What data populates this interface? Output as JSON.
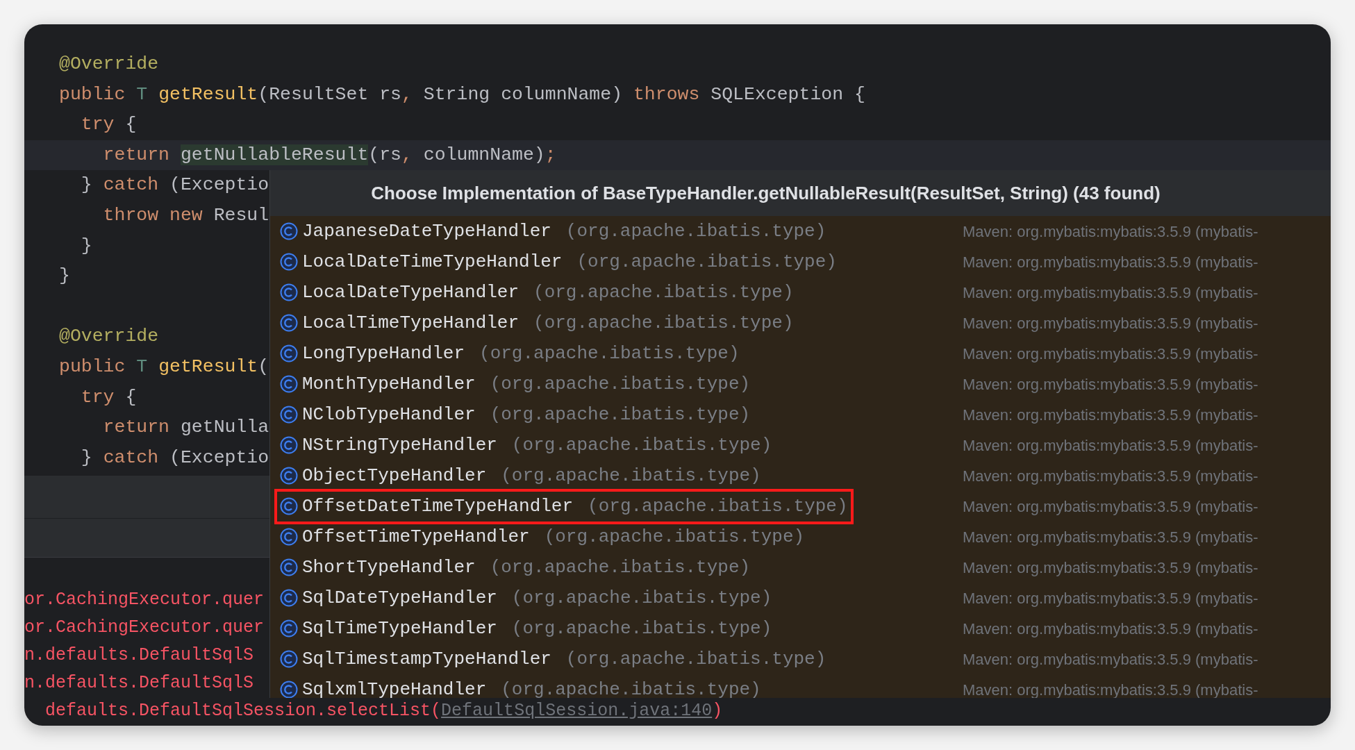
{
  "editor": {
    "lines": [
      {
        "current": false,
        "tokens": [
          {
            "kind": "annotation",
            "text": "@Override"
          }
        ]
      },
      {
        "current": false,
        "tokens": [
          {
            "kind": "keyword",
            "text": "public "
          },
          {
            "kind": "typeparam",
            "text": "T "
          },
          {
            "kind": "method",
            "text": "getResult"
          },
          {
            "kind": "plain",
            "text": "(ResultSet rs"
          },
          {
            "kind": "keyword",
            "text": ", "
          },
          {
            "kind": "plain",
            "text": "String columnName) "
          },
          {
            "kind": "keyword",
            "text": "throws "
          },
          {
            "kind": "plain",
            "text": "SQLException {"
          }
        ]
      },
      {
        "current": false,
        "tokens": [
          {
            "kind": "keyword",
            "text": "  try "
          },
          {
            "kind": "plain",
            "text": "{"
          }
        ]
      },
      {
        "current": true,
        "tokens": [
          {
            "kind": "keyword",
            "text": "    return "
          },
          {
            "kind": "usage",
            "text": "getNullableResult"
          },
          {
            "kind": "plain",
            "text": "(rs"
          },
          {
            "kind": "keyword",
            "text": ", "
          },
          {
            "kind": "plain",
            "text": "columnName)"
          },
          {
            "kind": "keyword",
            "text": ";"
          }
        ]
      },
      {
        "current": false,
        "tokens": [
          {
            "kind": "plain",
            "text": "  } "
          },
          {
            "kind": "keyword",
            "text": "catch "
          },
          {
            "kind": "plain",
            "text": "(Exceptio"
          }
        ]
      },
      {
        "current": false,
        "tokens": [
          {
            "kind": "keyword",
            "text": "    throw new "
          },
          {
            "kind": "plain",
            "text": "Resul"
          }
        ]
      },
      {
        "current": false,
        "tokens": [
          {
            "kind": "plain",
            "text": "  }"
          }
        ]
      },
      {
        "current": false,
        "tokens": [
          {
            "kind": "plain",
            "text": "}"
          }
        ]
      },
      {
        "current": false
      },
      {
        "current": false,
        "tokens": [
          {
            "kind": "annotation",
            "text": "@Override"
          }
        ]
      },
      {
        "current": false,
        "tokens": [
          {
            "kind": "keyword",
            "text": "public "
          },
          {
            "kind": "typeparam",
            "text": "T "
          },
          {
            "kind": "method",
            "text": "getResult"
          },
          {
            "kind": "plain",
            "text": "("
          }
        ]
      },
      {
        "current": false,
        "tokens": [
          {
            "kind": "keyword",
            "text": "  try "
          },
          {
            "kind": "plain",
            "text": "{"
          }
        ]
      },
      {
        "current": false,
        "tokens": [
          {
            "kind": "keyword",
            "text": "    return "
          },
          {
            "kind": "plain",
            "text": "getNulla"
          }
        ]
      },
      {
        "current": false,
        "tokens": [
          {
            "kind": "plain",
            "text": "  } "
          },
          {
            "kind": "keyword",
            "text": "catch "
          },
          {
            "kind": "plain",
            "text": "(Exceptio"
          }
        ]
      }
    ]
  },
  "console": {
    "lines": [
      {
        "segments": [
          {
            "kind": "error",
            "text": "or.CachingExecutor.quer"
          }
        ]
      },
      {
        "segments": [
          {
            "kind": "error",
            "text": "or.CachingExecutor.quer"
          }
        ]
      },
      {
        "segments": [
          {
            "kind": "error",
            "text": "n.defaults.DefaultSqlS"
          }
        ]
      },
      {
        "segments": [
          {
            "kind": "error",
            "text": "n.defaults.DefaultSqlS"
          }
        ]
      },
      {
        "segments": [
          {
            "kind": "error",
            "text": "  defaults.DefaultSqlSession.selectList("
          },
          {
            "kind": "link",
            "text": "DefaultSqlSession.java:140"
          },
          {
            "kind": "error",
            "text": ")"
          }
        ]
      }
    ]
  },
  "popup": {
    "title": "Choose Implementation of BaseTypeHandler.getNullableResult(ResultSet, String) (43 found)",
    "items": [
      {
        "name": "JapaneseDateTypeHandler",
        "package": "(org.apache.ibatis.type)",
        "library": "Maven: org.mybatis:mybatis:3.5.9 (mybatis-",
        "highlighted": false
      },
      {
        "name": "LocalDateTimeTypeHandler",
        "package": "(org.apache.ibatis.type)",
        "library": "Maven: org.mybatis:mybatis:3.5.9 (mybatis-",
        "highlighted": false
      },
      {
        "name": "LocalDateTypeHandler",
        "package": "(org.apache.ibatis.type)",
        "library": "Maven: org.mybatis:mybatis:3.5.9 (mybatis-",
        "highlighted": false
      },
      {
        "name": "LocalTimeTypeHandler",
        "package": "(org.apache.ibatis.type)",
        "library": "Maven: org.mybatis:mybatis:3.5.9 (mybatis-",
        "highlighted": false
      },
      {
        "name": "LongTypeHandler",
        "package": "(org.apache.ibatis.type)",
        "library": "Maven: org.mybatis:mybatis:3.5.9 (mybatis-",
        "highlighted": false
      },
      {
        "name": "MonthTypeHandler",
        "package": "(org.apache.ibatis.type)",
        "library": "Maven: org.mybatis:mybatis:3.5.9 (mybatis-",
        "highlighted": false
      },
      {
        "name": "NClobTypeHandler",
        "package": "(org.apache.ibatis.type)",
        "library": "Maven: org.mybatis:mybatis:3.5.9 (mybatis-",
        "highlighted": false
      },
      {
        "name": "NStringTypeHandler",
        "package": "(org.apache.ibatis.type)",
        "library": "Maven: org.mybatis:mybatis:3.5.9 (mybatis-",
        "highlighted": false
      },
      {
        "name": "ObjectTypeHandler",
        "package": "(org.apache.ibatis.type)",
        "library": "Maven: org.mybatis:mybatis:3.5.9 (mybatis-",
        "highlighted": false
      },
      {
        "name": "OffsetDateTimeTypeHandler",
        "package": "(org.apache.ibatis.type)",
        "library": "Maven: org.mybatis:mybatis:3.5.9 (mybatis-",
        "highlighted": true
      },
      {
        "name": "OffsetTimeTypeHandler",
        "package": "(org.apache.ibatis.type)",
        "library": "Maven: org.mybatis:mybatis:3.5.9 (mybatis-",
        "highlighted": false
      },
      {
        "name": "ShortTypeHandler",
        "package": "(org.apache.ibatis.type)",
        "library": "Maven: org.mybatis:mybatis:3.5.9 (mybatis-",
        "highlighted": false
      },
      {
        "name": "SqlDateTypeHandler",
        "package": "(org.apache.ibatis.type)",
        "library": "Maven: org.mybatis:mybatis:3.5.9 (mybatis-",
        "highlighted": false
      },
      {
        "name": "SqlTimeTypeHandler",
        "package": "(org.apache.ibatis.type)",
        "library": "Maven: org.mybatis:mybatis:3.5.9 (mybatis-",
        "highlighted": false
      },
      {
        "name": "SqlTimestampTypeHandler",
        "package": "(org.apache.ibatis.type)",
        "library": "Maven: org.mybatis:mybatis:3.5.9 (mybatis-",
        "highlighted": false
      },
      {
        "name": "SqlxmlTypeHandler",
        "package": "(org.apache.ibatis.type)",
        "library": "Maven: org.mybatis:mybatis:3.5.9 (mybatis-",
        "highlighted": false
      }
    ]
  }
}
